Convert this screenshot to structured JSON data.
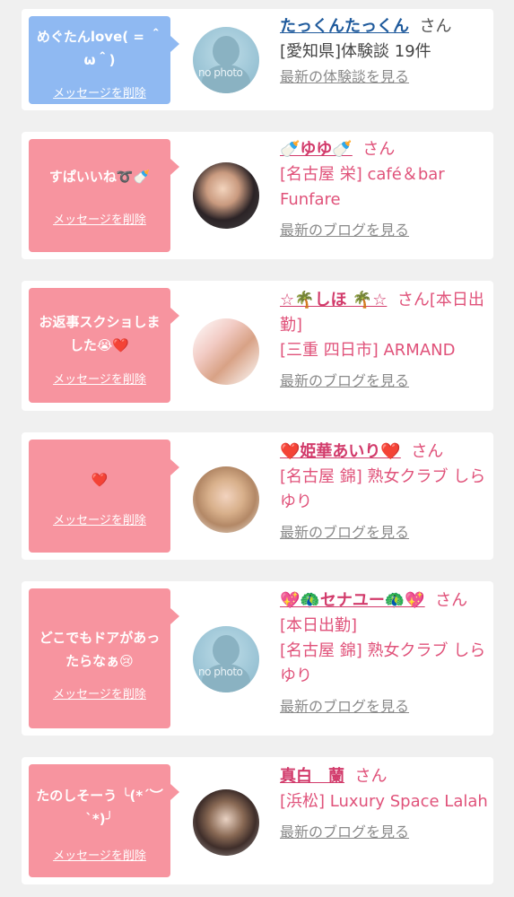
{
  "messages": [
    {
      "bubble_text": "めぐたんlove( = ＾ω＾)",
      "delete_label": "メッセージを削除",
      "sender_name": "たっくんたっくん",
      "honorific": "さん",
      "details": [
        "[愛知県]体験談 19件"
      ],
      "link_label": "最新の体験談を見る",
      "avatar_alt": "no photo",
      "colors": {
        "bubble": "#8fb9f2"
      }
    },
    {
      "bubble_text": "すぱいいね➰🍼",
      "delete_label": "メッセージを削除",
      "sender_name": "🍼ゆゆ🍼",
      "honorific": "さん",
      "details": [
        "[名古屋 栄] café＆bar Funfare"
      ],
      "link_label": "最新のブログを見る",
      "colors": {
        "bubble": "#f7949f"
      }
    },
    {
      "bubble_text": "お返事スクショしました😭❤️",
      "delete_label": "メッセージを削除",
      "sender_name": "☆🌴しほ 🌴☆",
      "honorific": "さん[本日出勤]",
      "details": [
        "[三重 四日市] ARMAND"
      ],
      "link_label": "最新のブログを見る",
      "colors": {
        "bubble": "#f7949f"
      }
    },
    {
      "bubble_text": "❤️",
      "delete_label": "メッセージを削除",
      "sender_name": "❤️姫華あいり❤️",
      "honorific": "さん",
      "details": [
        "[名古屋 錦] 熟女クラブ しらゆり"
      ],
      "link_label": "最新のブログを見る",
      "colors": {
        "bubble": "#f7949f"
      }
    },
    {
      "bubble_text": "どこでもドアがあったらなぁ😢",
      "delete_label": "メッセージを削除",
      "sender_name": "💖🦚セナユー🦚💖",
      "honorific": "さん",
      "details": [
        "[本日出勤]",
        "[名古屋 錦] 熟女クラブ しらゆり"
      ],
      "link_label": "最新のブログを見る",
      "avatar_alt": "no photo",
      "colors": {
        "bubble": "#f7949f"
      }
    },
    {
      "bubble_text": "たのしそーう ╰(*´︶`*)╯",
      "delete_label": "メッセージを削除",
      "sender_name": "真白　蘭",
      "honorific": "さん",
      "details": [
        "[浜松] Luxury Space Lalah"
      ],
      "link_label": "最新のブログを見る",
      "colors": {
        "bubble": "#f7949f"
      }
    }
  ]
}
